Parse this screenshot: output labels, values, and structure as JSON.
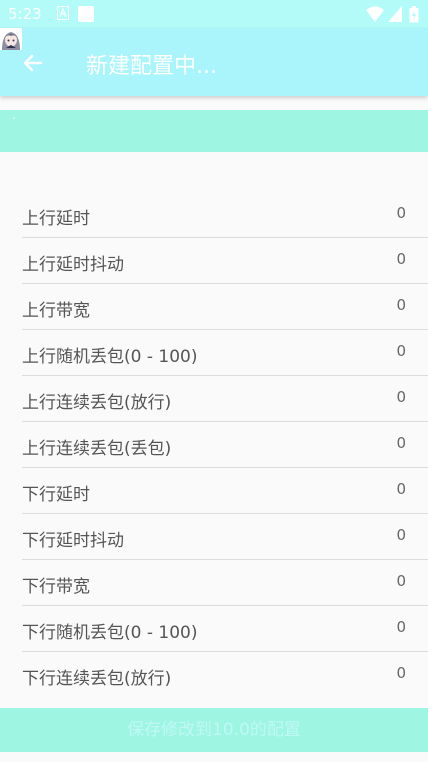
{
  "status_bar": {
    "time": "5:23"
  },
  "app_bar": {
    "title": "新建配置中..."
  },
  "settings": [
    {
      "label": "上行延时",
      "value": "0"
    },
    {
      "label": "上行延时抖动",
      "value": "0"
    },
    {
      "label": "上行带宽",
      "value": "0"
    },
    {
      "label": "上行随机丢包(0 - 100)",
      "value": "0"
    },
    {
      "label": "上行连续丢包(放行)",
      "value": "0"
    },
    {
      "label": "上行连续丢包(丢包)",
      "value": "0"
    },
    {
      "label": "下行延时",
      "value": "0"
    },
    {
      "label": "下行延时抖动",
      "value": "0"
    },
    {
      "label": "下行带宽",
      "value": "0"
    },
    {
      "label": "下行随机丢包(0 - 100)",
      "value": "0"
    },
    {
      "label": "下行连续丢包(放行)",
      "value": "0"
    }
  ],
  "footer": {
    "button_label": "保存修改到10.0的配置"
  },
  "colors": {
    "status_bar": "#b3fbf8",
    "app_bar": "#a9f5fb",
    "accent_band": "#9df5e2"
  }
}
